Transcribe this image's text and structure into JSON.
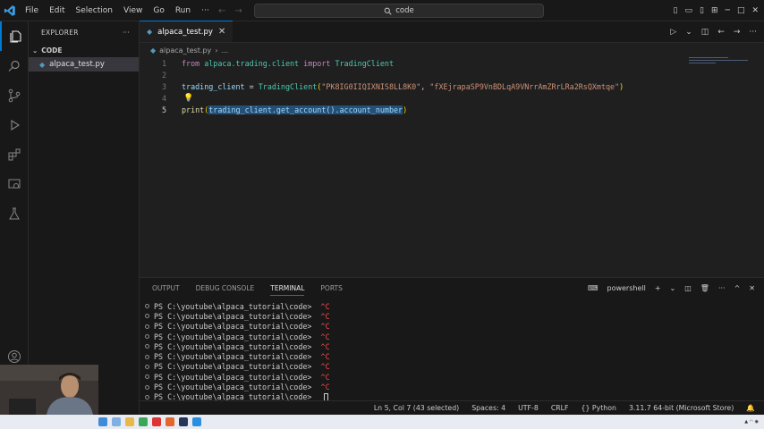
{
  "window": {
    "search_label": "code"
  },
  "menu": {
    "items": [
      "File",
      "Edit",
      "Selection",
      "View",
      "Go",
      "Run",
      "···"
    ]
  },
  "sidebar": {
    "header": "EXPLORER",
    "section": "CODE",
    "files": [
      "alpaca_test.py"
    ]
  },
  "editor": {
    "tab_label": "alpaca_test.py",
    "breadcrumb_file": "alpaca_test.py",
    "breadcrumb_more": "...",
    "line_numbers": [
      "1",
      "2",
      "3",
      "4",
      "5"
    ],
    "line1": {
      "kw1": "from",
      "module": "alpaca.trading.client",
      "kw2": "import",
      "cls": "TradingClient"
    },
    "line3": {
      "var": "trading_client",
      "eq": " = ",
      "cls": "TradingClient",
      "lp": "(",
      "key": "\"PK8IG0IIQIXNIS8LL8K0\"",
      "comma": ", ",
      "secret": "\"fXEjrapaSP9VnBDLqA9VNrrAmZRrLRa2RsQXmtqe\"",
      "rp": ")"
    },
    "line5": {
      "fn": "print",
      "lp": "(",
      "selected_text": "trading_client.get_account().account_number",
      "rp": ")"
    }
  },
  "panel": {
    "tabs": [
      "OUTPUT",
      "DEBUG CONSOLE",
      "TERMINAL",
      "PORTS"
    ],
    "active_tab": "TERMINAL",
    "shell": "powershell",
    "prompt": "PS C:\\youtube\\alpaca_tutorial\\code> ",
    "interrupt": "^C",
    "interrupted_lines": 9
  },
  "status": {
    "position": "Ln 5, Col 7 (43 selected)",
    "spaces": "Spaces: 4",
    "encoding": "UTF-8",
    "eol": "CRLF",
    "language": "Python",
    "interpreter": "3.11.7 64-bit (Microsoft Store)"
  }
}
